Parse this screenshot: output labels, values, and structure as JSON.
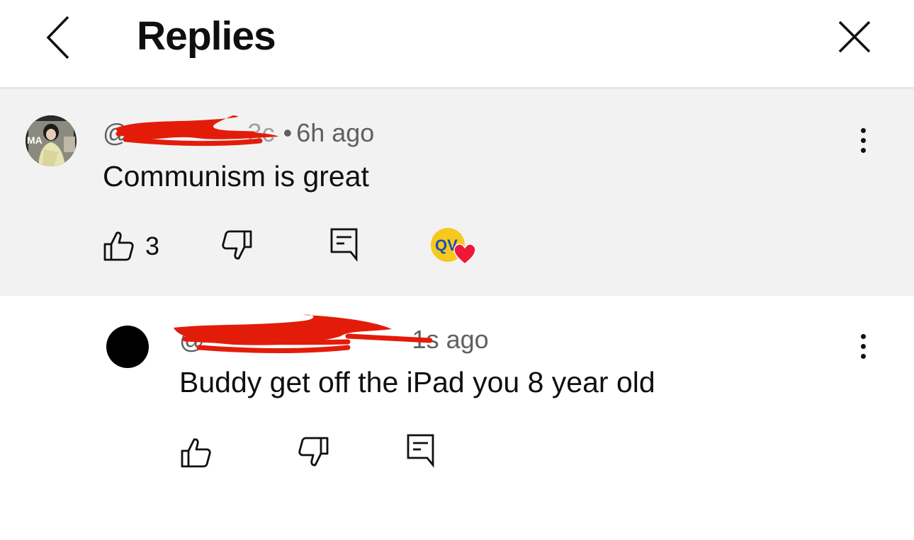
{
  "header": {
    "title": "Replies"
  },
  "icons": {
    "back": "chevron-left-icon",
    "close": "close-icon",
    "more": "more-vertical-icon",
    "like": "thumbs-up-icon",
    "dislike": "thumbs-down-icon",
    "reply": "reply-comment-icon",
    "creator_heart": "creator-heart-icon"
  },
  "parent_comment": {
    "handle_prefix": "@",
    "handle_visible_tail": "3c",
    "separator": "•",
    "timestamp": "6h ago",
    "text": "Communism is great",
    "like_count": "3",
    "creator_badge_text": "QV"
  },
  "reply_comment": {
    "handle_prefix": "@",
    "timestamp": "1s ago",
    "text": "Buddy get off the iPad you 8 year old"
  },
  "colors": {
    "background": "#ffffff",
    "highlight_background": "#f2f2f2",
    "divider": "#e5e5e5",
    "meta_text": "#606060",
    "primary_text": "#0f0f0f",
    "redaction": "#e31c0a",
    "heart": "#f01838",
    "creator_avatar": "#f7c81e"
  }
}
